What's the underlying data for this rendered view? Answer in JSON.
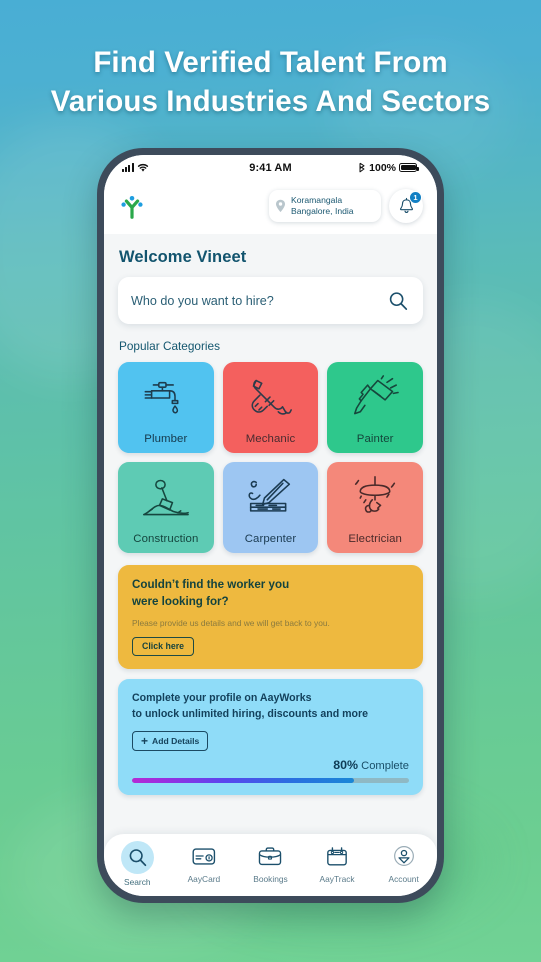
{
  "headline": {
    "line1": "Find Verified Talent From",
    "line2": "Various Industries And Sectors"
  },
  "colors": {
    "bg_top": "#49aed4",
    "bg_mid": "#5dbfac",
    "bg_bottom": "#71d295",
    "phone_frame": "#3d4b5b",
    "accent_blue": "#1280c4",
    "text_dark_teal": "#12546e",
    "yellow_card": "#eeb93f",
    "blue_card": "#8fdcf8"
  },
  "status_bar": {
    "signal_icon": "cellular-bars-icon",
    "wifi_icon": "wifi-icon",
    "time": "9:41 AM",
    "bluetooth_icon": "bluetooth-icon",
    "battery_percent": "100%",
    "battery_icon": "battery-full-icon"
  },
  "header": {
    "logo_icon": "aayworks-logo-icon",
    "location": {
      "pin_icon": "location-pin-icon",
      "line1": "Koramangala",
      "line2": "Bangalore, India"
    },
    "notification": {
      "bell_icon": "bell-icon",
      "badge_count": "1"
    }
  },
  "main": {
    "welcome_text": "Welcome Vineet",
    "search": {
      "placeholder": "Who do you want to hire?",
      "icon": "search-icon"
    },
    "section_title": "Popular Categories",
    "categories": [
      {
        "label": "Plumber",
        "icon": "faucet-tap-icon",
        "bg": "#51c3f0",
        "label_color": "#15384b"
      },
      {
        "label": "Mechanic",
        "icon": "wrench-hand-icon",
        "bg": "#f4605e",
        "label_color": "#4a2b30"
      },
      {
        "label": "Painter",
        "icon": "paint-brush-icon",
        "bg": "#2ec88c",
        "label_color": "#15463b"
      },
      {
        "label": "Construction",
        "icon": "shovel-dirt-pile-icon",
        "bg": "#5ecbb4",
        "label_color": "#15463f"
      },
      {
        "label": "Carpenter",
        "icon": "chisel-wood-plank-icon",
        "bg": "#9dc6f2",
        "label_color": "#1b3b52"
      },
      {
        "label": "Electrician",
        "icon": "lamp-hand-icon",
        "bg": "#f4887a",
        "label_color": "#4a2a2a"
      }
    ],
    "promo_card": {
      "title_line1": "Couldn’t find the worker you",
      "title_line2": "were looking for?",
      "subtitle": "Please provide us details and we will get back to you.",
      "button_label": "Click here"
    },
    "profile_card": {
      "title_line1": "Complete your profile on AayWorks",
      "title_line2": "to unlock unlimited hiring, discounts and more",
      "button_label": "Add Details",
      "button_icon": "plus-icon",
      "progress_percent": "80%",
      "progress_label": "Complete",
      "progress_value": 80
    }
  },
  "bottom_nav": [
    {
      "label": "Search",
      "icon": "search-icon",
      "active": true
    },
    {
      "label": "AayCard",
      "icon": "card-icon",
      "active": false
    },
    {
      "label": "Bookings",
      "icon": "briefcase-icon",
      "active": false
    },
    {
      "label": "AayTrack",
      "icon": "calendar-icon",
      "active": false
    },
    {
      "label": "Account",
      "icon": "user-icon",
      "active": false
    }
  ]
}
